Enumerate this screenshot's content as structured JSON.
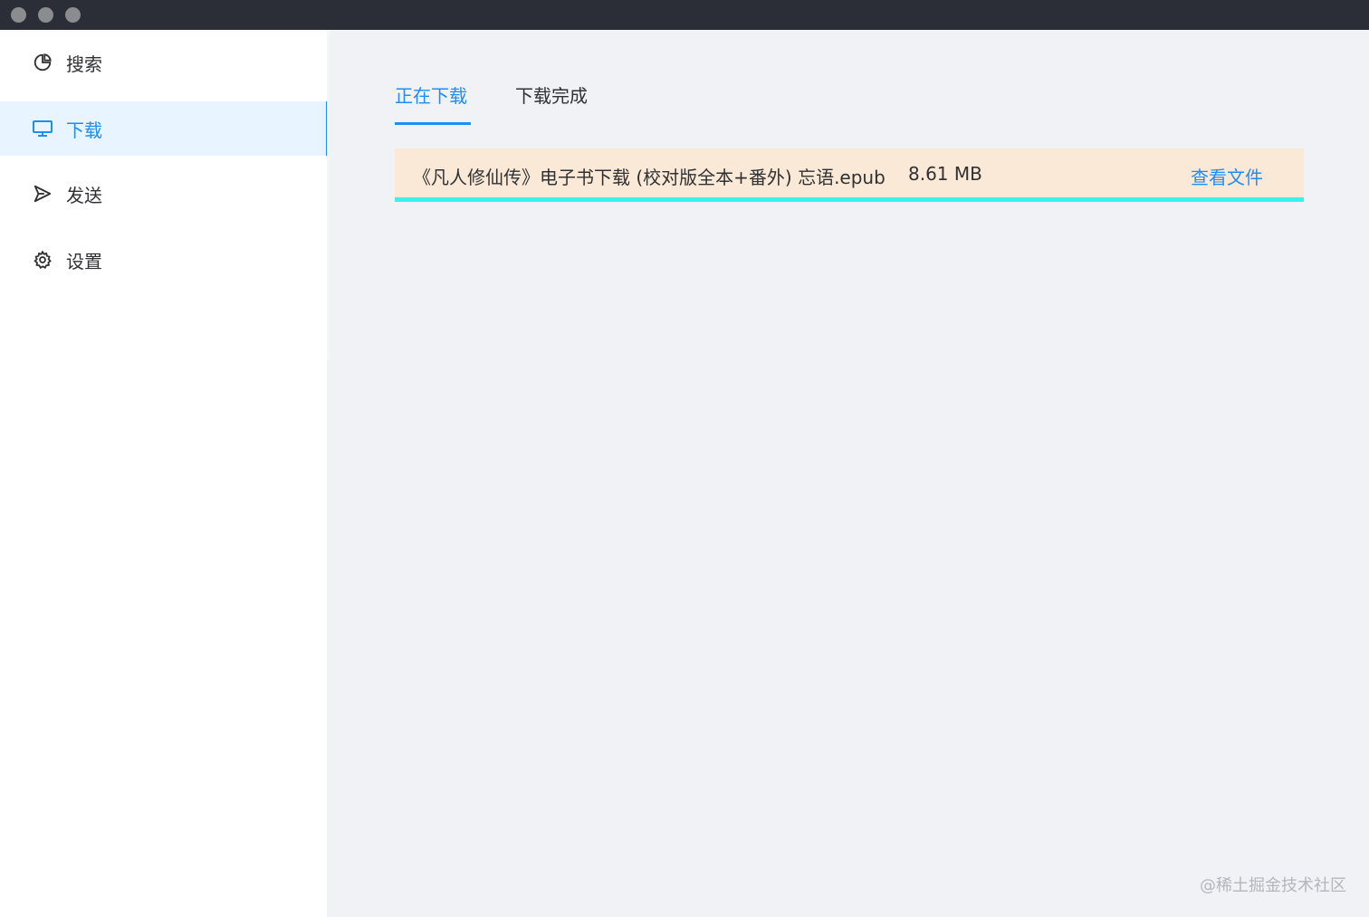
{
  "window": {
    "colors": {
      "titlebar": "#2b2e36",
      "accent": "#1f8ef1",
      "progress": "#3cf0f0",
      "row_bg": "#fbe9d7"
    }
  },
  "sidebar": {
    "items": [
      {
        "label": "搜索",
        "icon": "pie-chart-icon",
        "active": false
      },
      {
        "label": "下载",
        "icon": "monitor-icon",
        "active": true
      },
      {
        "label": "发送",
        "icon": "send-icon",
        "active": false
      },
      {
        "label": "设置",
        "icon": "gear-icon",
        "active": false
      }
    ]
  },
  "main": {
    "tabs": [
      {
        "label": "正在下载",
        "active": true
      },
      {
        "label": "下载完成",
        "active": false
      }
    ],
    "downloads": [
      {
        "file_name": "《凡人修仙传》电子书下载 (校对版全本+番外) 忘语.epub",
        "size": "8.61 MB",
        "action_label": "查看文件",
        "progress": 1.0
      }
    ]
  },
  "watermark": "@稀土掘金技术社区"
}
